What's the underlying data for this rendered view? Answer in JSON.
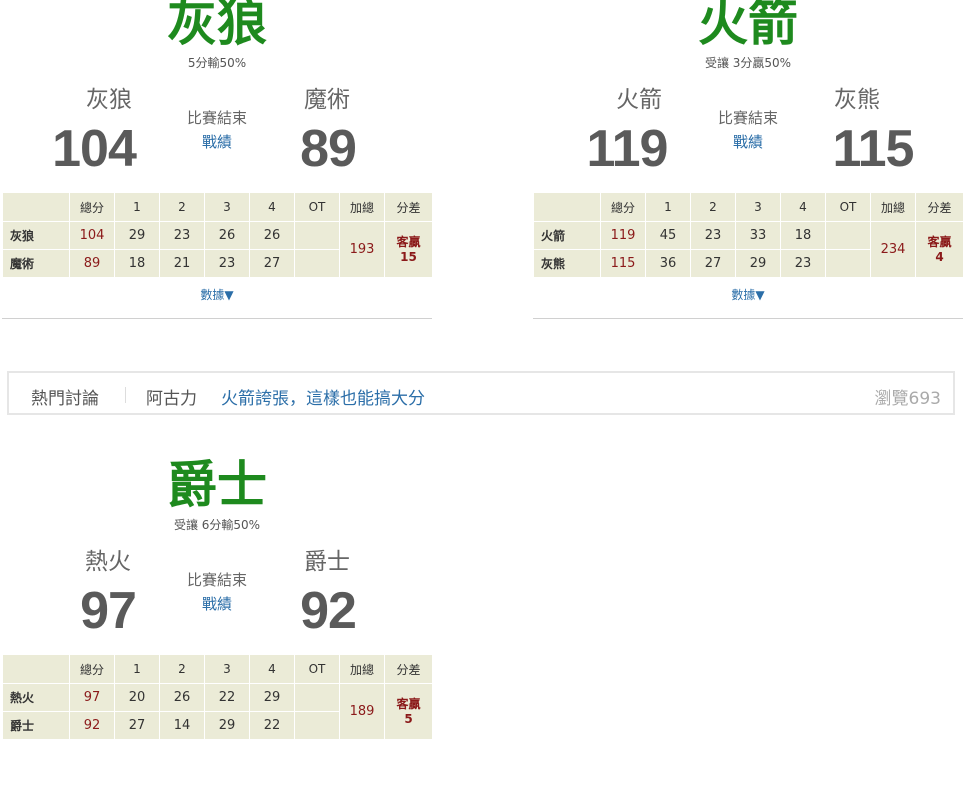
{
  "games": [
    {
      "pick": "灰狼",
      "line": "5分輸50%",
      "left_team": "灰狼",
      "left_score": "104",
      "right_team": "魔術",
      "right_score": "89",
      "status": "比賽結束",
      "record": "戰績",
      "headers": [
        "",
        "總分",
        "1",
        "2",
        "3",
        "4",
        "OT",
        "加總",
        "分差"
      ],
      "rows": [
        {
          "team": "灰狼",
          "total": "104",
          "q1": "29",
          "q2": "23",
          "q3": "26",
          "q4": "26",
          "ot": ""
        },
        {
          "team": "魔術",
          "total": "89",
          "q1": "18",
          "q2": "21",
          "q3": "23",
          "q4": "27",
          "ot": ""
        }
      ],
      "sum": "193",
      "diff_label": "客贏",
      "diff_value": "15",
      "data_link": "數據▼"
    },
    {
      "pick": "火箭",
      "line": "受讓 3分贏50%",
      "left_team": "火箭",
      "left_score": "119",
      "right_team": "灰熊",
      "right_score": "115",
      "status": "比賽結束",
      "record": "戰績",
      "headers": [
        "",
        "總分",
        "1",
        "2",
        "3",
        "4",
        "OT",
        "加總",
        "分差"
      ],
      "rows": [
        {
          "team": "火箭",
          "total": "119",
          "q1": "45",
          "q2": "23",
          "q3": "33",
          "q4": "18",
          "ot": ""
        },
        {
          "team": "灰熊",
          "total": "115",
          "q1": "36",
          "q2": "27",
          "q3": "29",
          "q4": "23",
          "ot": ""
        }
      ],
      "sum": "234",
      "diff_label": "客贏",
      "diff_value": "4",
      "data_link": "數據▼"
    },
    {
      "pick": "爵士",
      "line": "受讓 6分輸50%",
      "left_team": "熱火",
      "left_score": "97",
      "right_team": "爵士",
      "right_score": "92",
      "status": "比賽結束",
      "record": "戰績",
      "headers": [
        "",
        "總分",
        "1",
        "2",
        "3",
        "4",
        "OT",
        "加總",
        "分差"
      ],
      "rows": [
        {
          "team": "熱火",
          "total": "97",
          "q1": "20",
          "q2": "26",
          "q3": "22",
          "q4": "29",
          "ot": ""
        },
        {
          "team": "爵士",
          "total": "92",
          "q1": "27",
          "q2": "14",
          "q3": "29",
          "q4": "22",
          "ot": ""
        }
      ],
      "sum": "189",
      "diff_label": "客贏",
      "diff_value": "5",
      "data_link": ""
    }
  ],
  "hot_topic": {
    "label": "熱門討論",
    "author": "阿古力",
    "title": "火箭誇張，這樣也能搞大分",
    "views": "瀏覽693"
  }
}
